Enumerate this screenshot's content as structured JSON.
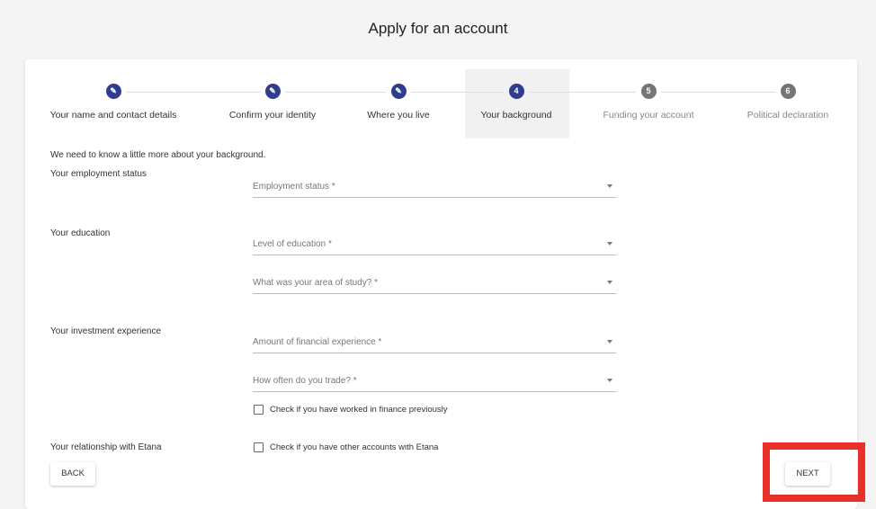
{
  "page_title": "Apply for an account",
  "stepper": {
    "steps": [
      {
        "label": "Your name and contact details",
        "state": "completed",
        "icon": "pencil-icon"
      },
      {
        "label": "Confirm your identity",
        "state": "completed",
        "icon": "pencil-icon"
      },
      {
        "label": "Where you live",
        "state": "completed",
        "icon": "pencil-icon"
      },
      {
        "label": "Your background",
        "state": "active",
        "number": "4"
      },
      {
        "label": "Funding your account",
        "state": "pending",
        "number": "5"
      },
      {
        "label": "Political declaration",
        "state": "pending",
        "number": "6"
      }
    ],
    "accent_color": "#2f3d8f"
  },
  "form": {
    "intro": "We need to know a little more about your background.",
    "sections": {
      "employment": "Your employment status",
      "education": "Your education",
      "investment": "Your investment experience",
      "relationship": "Your relationship with Etana"
    },
    "fields": {
      "employment_status": {
        "placeholder": "Employment status *",
        "value": ""
      },
      "education_level": {
        "placeholder": "Level of education *",
        "value": ""
      },
      "area_of_study": {
        "placeholder": "What was your area of study? *",
        "value": ""
      },
      "financial_experience": {
        "placeholder": "Amount of financial experience *",
        "value": ""
      },
      "trade_frequency": {
        "placeholder": "How often do you trade? *",
        "value": ""
      }
    },
    "checkboxes": {
      "worked_in_finance": {
        "label": "Check if you have worked in finance previously",
        "checked": false
      },
      "other_accounts": {
        "label": "Check if you have other accounts with Etana",
        "checked": false
      }
    }
  },
  "buttons": {
    "back": "BACK",
    "next": "NEXT"
  },
  "highlight_color": "#e8302a"
}
